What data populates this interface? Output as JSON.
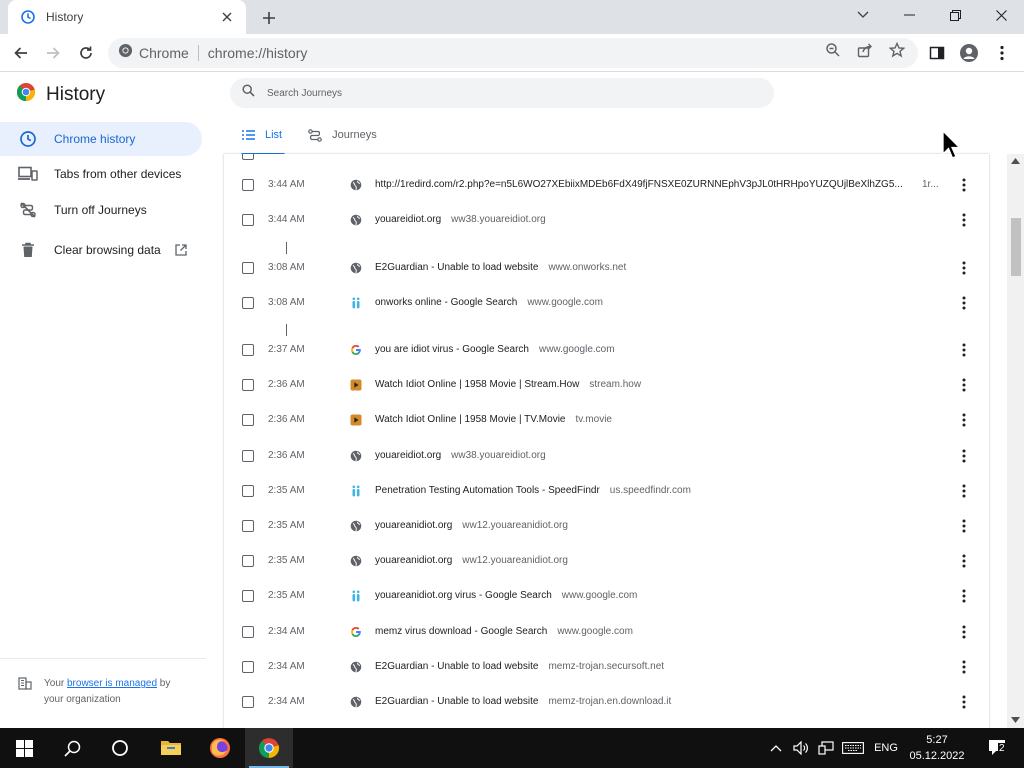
{
  "browser": {
    "tab_title": "History",
    "chip_label": "Chrome",
    "url": "chrome://history"
  },
  "sidebar": {
    "title": "History",
    "items": [
      {
        "label": "Chrome history",
        "icon": "clock-icon",
        "active": true
      },
      {
        "label": "Tabs from other devices",
        "icon": "devices-icon",
        "active": false
      },
      {
        "label": "Turn off Journeys",
        "icon": "journeys-off-icon",
        "active": false
      },
      {
        "label": "Clear browsing data",
        "icon": "trash-icon",
        "active": false
      }
    ],
    "managed": {
      "prefix": "Your ",
      "link": "browser is managed",
      "suffix": " by",
      "line2": "your organization"
    }
  },
  "search": {
    "placeholder": "Search Journeys"
  },
  "view_tabs": [
    {
      "label": "List",
      "active": true
    },
    {
      "label": "Journeys",
      "active": false
    }
  ],
  "history": [
    {
      "time": "3:44 AM",
      "title": "http://1redird.com/r2.php?e=n5L6WO27XEbiixMDEb6FdX49fjFNSXE0ZURNNEphV3pJL0tHRHpoYUZQUjlBeXlhZG5...",
      "domain": "",
      "extra": "1r...",
      "favicon": "globe"
    },
    {
      "time": "3:44 AM",
      "title": "youareidiot.org",
      "domain": "ww38.youareidiot.org",
      "favicon": "globe"
    },
    {
      "time": "3:08 AM",
      "title": "E2Guardian - Unable to load website",
      "domain": "www.onworks.net",
      "favicon": "globe"
    },
    {
      "time": "3:08 AM",
      "title": "onworks online - Google Search",
      "domain": "www.google.com",
      "favicon": "speedfindr"
    },
    {
      "time": "2:37 AM",
      "title": "you are idiot virus - Google Search",
      "domain": "www.google.com",
      "favicon": "google"
    },
    {
      "time": "2:36 AM",
      "title": "Watch Idiot Online | 1958 Movie | Stream.How",
      "domain": "stream.how",
      "favicon": "movie"
    },
    {
      "time": "2:36 AM",
      "title": "Watch Idiot Online | 1958 Movie | TV.Movie",
      "domain": "tv.movie",
      "favicon": "movie"
    },
    {
      "time": "2:36 AM",
      "title": "youareidiot.org",
      "domain": "ww38.youareidiot.org",
      "favicon": "globe"
    },
    {
      "time": "2:35 AM",
      "title": "Penetration Testing Automation Tools - SpeedFindr",
      "domain": "us.speedfindr.com",
      "favicon": "speedfindr"
    },
    {
      "time": "2:35 AM",
      "title": "youareanidiot.org",
      "domain": "ww12.youareanidiot.org",
      "favicon": "globe"
    },
    {
      "time": "2:35 AM",
      "title": "youareanidiot.org",
      "domain": "ww12.youareanidiot.org",
      "favicon": "globe"
    },
    {
      "time": "2:35 AM",
      "title": "youareanidiot.org virus - Google Search",
      "domain": "www.google.com",
      "favicon": "speedfindr"
    },
    {
      "time": "2:34 AM",
      "title": "memz virus download - Google Search",
      "domain": "www.google.com",
      "favicon": "google"
    },
    {
      "time": "2:34 AM",
      "title": "E2Guardian - Unable to load website",
      "domain": "memz-trojan.secursoft.net",
      "favicon": "globe"
    },
    {
      "time": "2:34 AM",
      "title": "E2Guardian - Unable to load website",
      "domain": "memz-trojan.en.download.it",
      "favicon": "globe"
    }
  ],
  "taskbar": {
    "language": "ENG",
    "time": "5:27",
    "date": "05.12.2022",
    "notifications": "2"
  },
  "colors": {
    "accent": "#1a73e8",
    "active_nav_bg": "#e8f0fe",
    "taskbar": "#101010"
  }
}
